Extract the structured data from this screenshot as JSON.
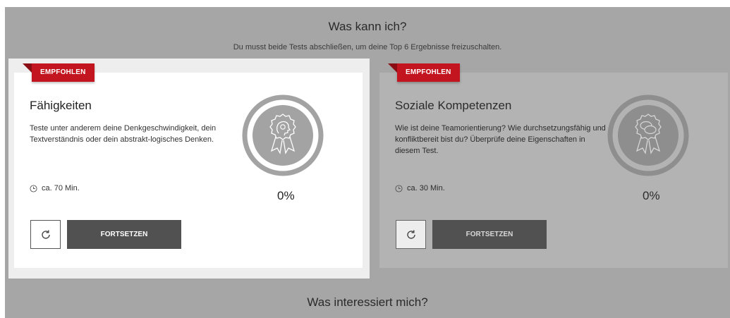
{
  "header": {
    "title": "Was kann ich?",
    "subtitle": "Du musst beide Tests abschließen, um deine Top 6 Ergebnisse freizuschalten."
  },
  "cards": [
    {
      "ribbon": "EMPFOHLEN",
      "title": "Fähigkeiten",
      "description": "Teste unter anderem deine Denkgeschwindigkeit, dein Textverständnis oder dein abstrakt-logisches Denken.",
      "duration": "ca. 70 Min.",
      "percent": "0%",
      "progress": 0,
      "button": "FORTSETZEN",
      "badge_icon": "head-gear-award-icon",
      "reload_icon": "reload-icon",
      "duration_icon": "clock-icon"
    },
    {
      "ribbon": "EMPFOHLEN",
      "title": "Soziale Kompetenzen",
      "description": "Wie ist deine Teamorientierung? Wie durchsetzungsfähig und konfliktbereit bist du? Überprüfe deine Eigenschaften in diesem Test.",
      "duration": "ca. 30 Min.",
      "percent": "0%",
      "progress": 0,
      "button": "FORTSETZEN",
      "badge_icon": "chat-bubbles-award-icon",
      "reload_icon": "reload-icon",
      "duration_icon": "clock-icon"
    }
  ],
  "next_section": {
    "title": "Was interessiert mich?"
  },
  "colors": {
    "ribbon": "#c3151f",
    "button": "#515151",
    "backdrop": "#a6a6a6"
  }
}
